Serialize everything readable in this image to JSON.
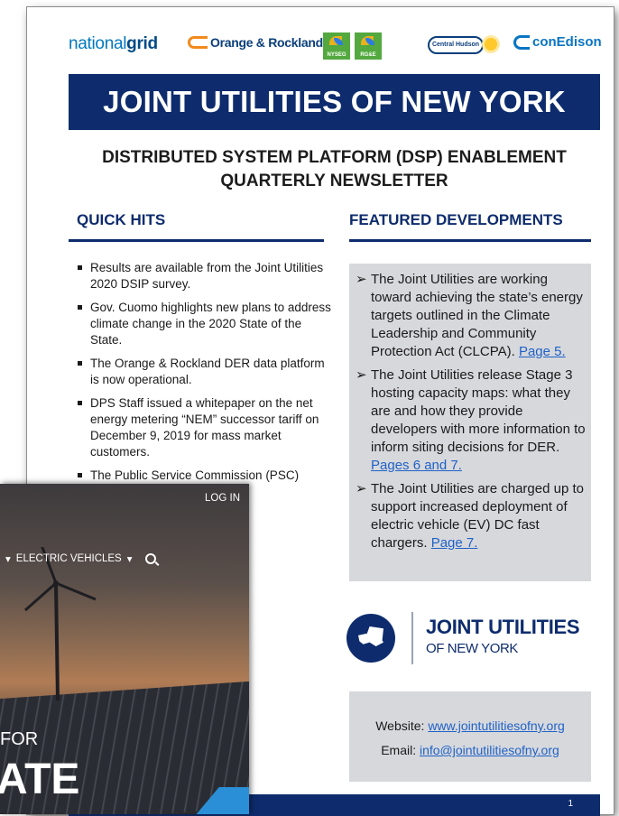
{
  "logos": {
    "national_grid_a": "national",
    "national_grid_b": "grid",
    "orange_rockland": "Orange & Rockland",
    "nyseg": "NYSEG",
    "rge": "RG&E",
    "central_hudson": "Central Hudson",
    "con_edison": "conEdison"
  },
  "banner": {
    "title": "JOINT UTILITIES OF NEW YORK"
  },
  "subtitle": {
    "line1": "DISTRIBUTED SYSTEM PLATFORM (DSP) ENABLEMENT",
    "line2": "QUARTERLY NEWSLETTER"
  },
  "quick_hits": {
    "heading": "QUICK HITS",
    "items": [
      "Results are available from the Joint Utilities 2020 DSIP survey.",
      "Gov. Cuomo highlights new plans to address climate change in the 2020 State of the State.",
      "The Orange & Rockland DER data platform is now operational.",
      "DPS Staff issued a whitepaper on the net energy metering “NEM” successor tariff on December 9, 2019 for mass market customers.",
      "The Public Service Commission (PSC)"
    ]
  },
  "featured": {
    "heading": "FEATURED DEVELOPMENTS",
    "items": [
      {
        "text": "The Joint Utilities are working toward achieving the state’s energy targets outlined in the Climate Leadership and Community Protection Act (CLCPA).",
        "link": "Page 5."
      },
      {
        "text": "The Joint Utilities release Stage 3 hosting capacity maps: what they are and how they provide developers with more information to inform siting decisions for DER.",
        "link": "Pages 6 and 7."
      },
      {
        "text": "The Joint Utilities are charged up to support increased deployment of electric vehicle (EV) DC fast chargers.",
        "link": "Page 7."
      }
    ]
  },
  "jointlogo": {
    "line1": "JOINT UTILITIES",
    "line2": "OF NEW YORK"
  },
  "contact": {
    "website_label": "Website:",
    "website_url": "www.jointutilitiesofny.org",
    "email_label": "Email:",
    "email_addr": "info@jointutilitiesofny.org"
  },
  "page_number": "1",
  "overlay": {
    "login": "LOG IN",
    "nav_item": "ELECTRIC VEHICLES",
    "hero_small": "FOR",
    "hero_big": "ATE"
  },
  "colors": {
    "navy": "#0e2c6d",
    "panel_gray": "#d7d8dc",
    "link": "#1f62c7"
  }
}
